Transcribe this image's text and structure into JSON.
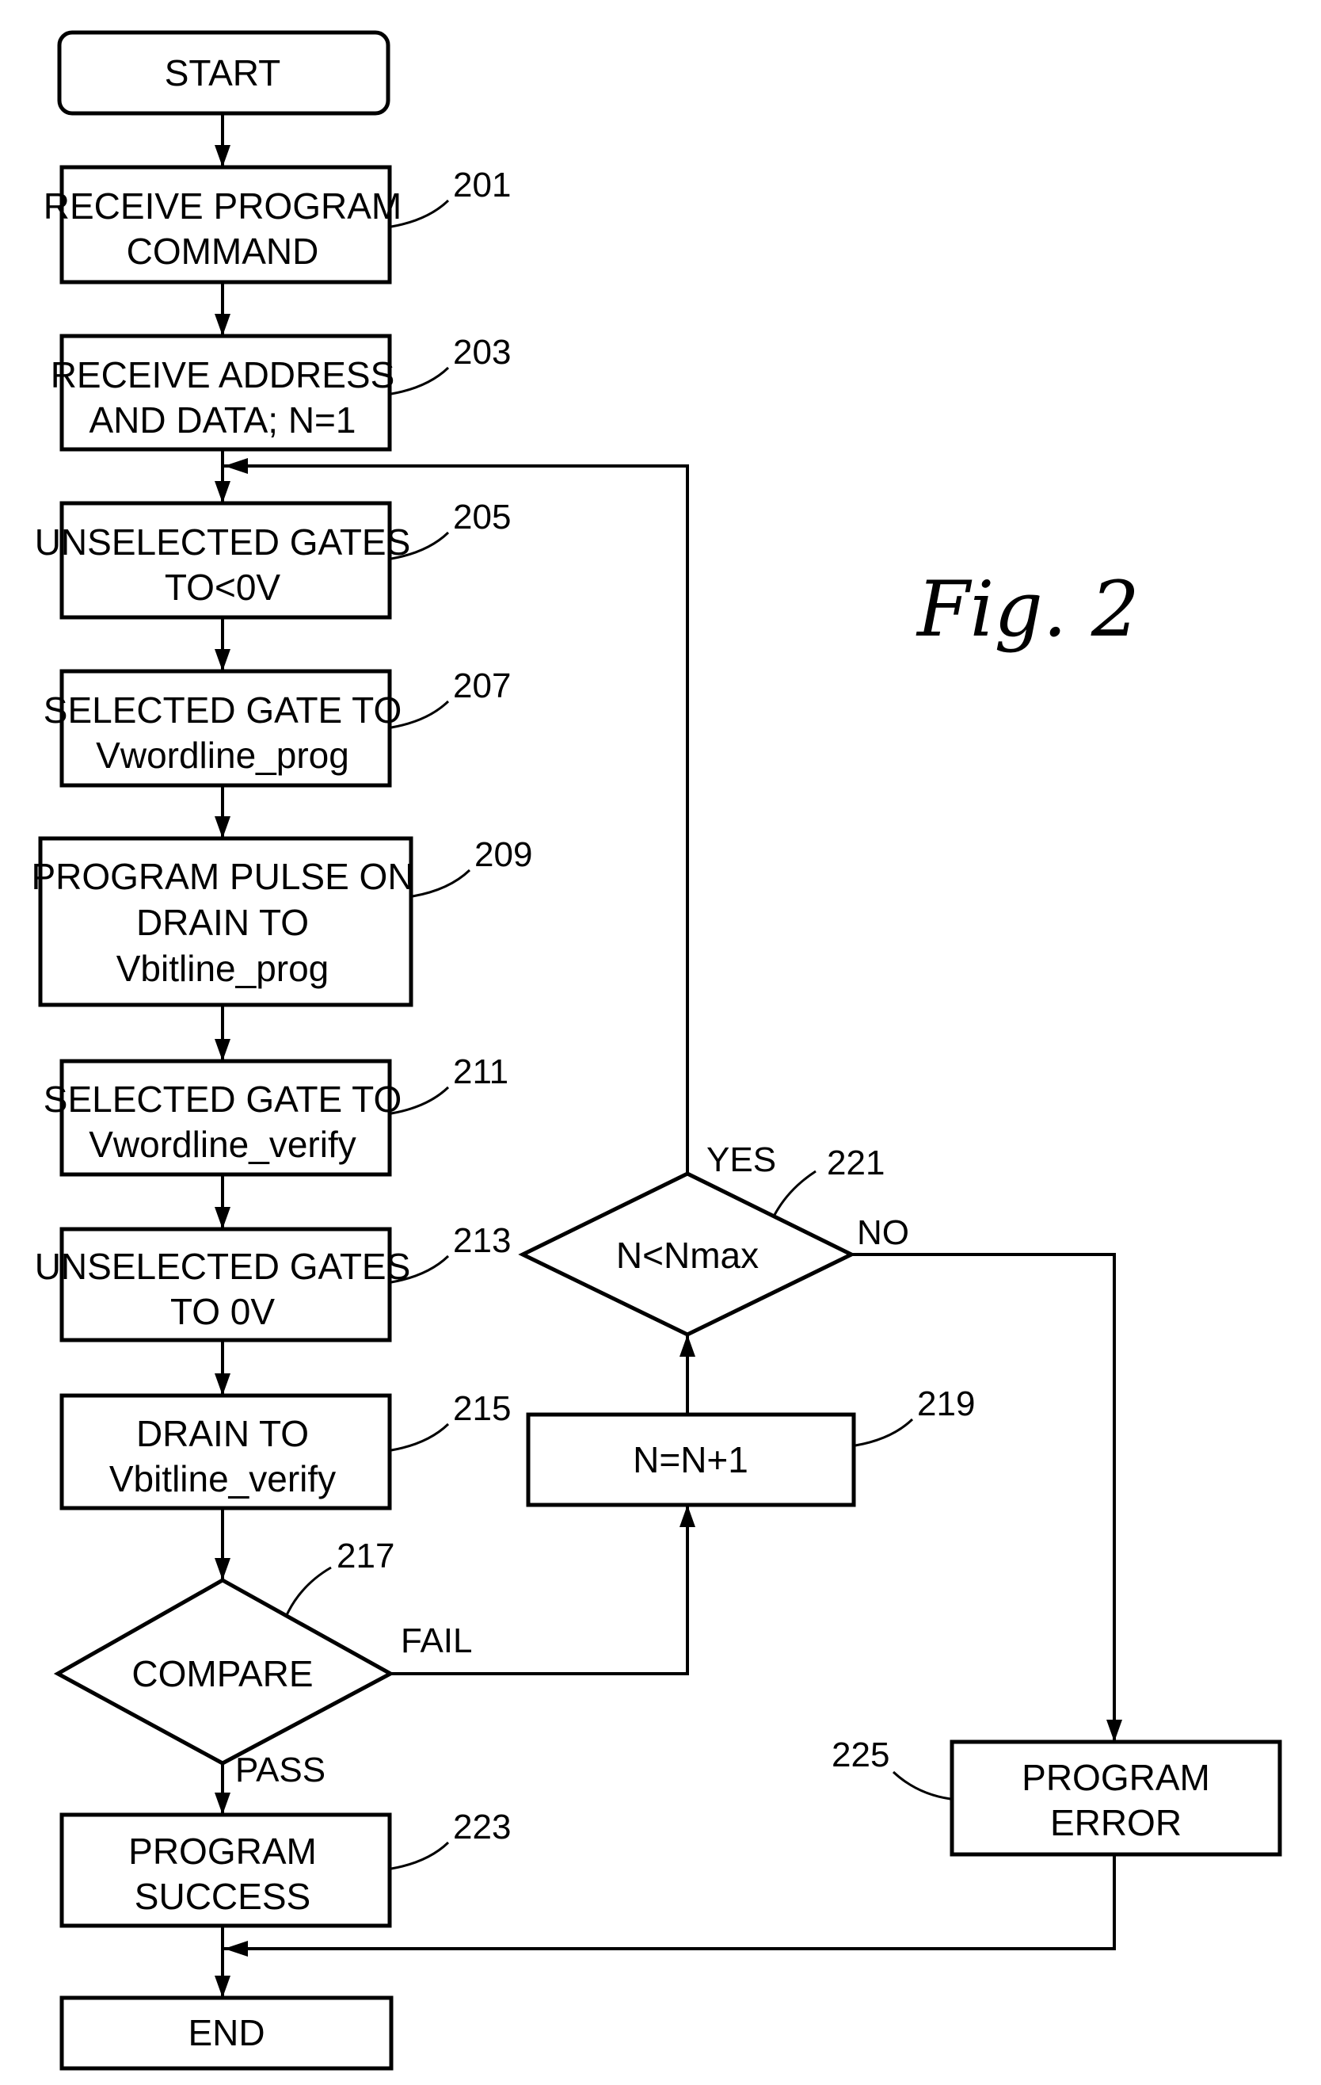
{
  "figure": {
    "title": "Fig. 2",
    "type": "flowchart"
  },
  "nodes": {
    "start": {
      "lines": [
        "START"
      ]
    },
    "n201": {
      "ref": "201",
      "lines": [
        "RECEIVE PROGRAM",
        "COMMAND"
      ]
    },
    "n203": {
      "ref": "203",
      "lines": [
        "RECEIVE ADDRESS",
        "AND DATA; N=1"
      ]
    },
    "n205": {
      "ref": "205",
      "lines": [
        "UNSELECTED GATES",
        "TO<0V"
      ]
    },
    "n207": {
      "ref": "207",
      "lines": [
        "SELECTED GATE TO",
        "Vwordline_prog"
      ]
    },
    "n209": {
      "ref": "209",
      "lines": [
        "PROGRAM PULSE ON",
        "DRAIN TO",
        "Vbitline_prog"
      ]
    },
    "n211": {
      "ref": "211",
      "lines": [
        "SELECTED GATE TO",
        "Vwordline_verify"
      ]
    },
    "n213": {
      "ref": "213",
      "lines": [
        "UNSELECTED GATES",
        "TO 0V"
      ]
    },
    "n215": {
      "ref": "215",
      "lines": [
        "DRAIN TO",
        "Vbitline_verify"
      ]
    },
    "n217": {
      "ref": "217",
      "lines": [
        "COMPARE"
      ]
    },
    "n219": {
      "ref": "219",
      "lines": [
        "N=N+1"
      ]
    },
    "n221": {
      "ref": "221",
      "lines": [
        "N<Nmax"
      ]
    },
    "n223": {
      "ref": "223",
      "lines": [
        "PROGRAM",
        "SUCCESS"
      ]
    },
    "n225": {
      "ref": "225",
      "lines": [
        "PROGRAM",
        "ERROR"
      ]
    },
    "end": {
      "lines": [
        "END"
      ]
    }
  },
  "edge_labels": {
    "fail": "FAIL",
    "pass": "PASS",
    "yes": "YES",
    "no": "NO"
  },
  "edges": [
    {
      "from": "start",
      "to": "n201"
    },
    {
      "from": "n201",
      "to": "n203"
    },
    {
      "from": "n203",
      "to": "n205"
    },
    {
      "from": "n205",
      "to": "n207"
    },
    {
      "from": "n207",
      "to": "n209"
    },
    {
      "from": "n209",
      "to": "n211"
    },
    {
      "from": "n211",
      "to": "n213"
    },
    {
      "from": "n213",
      "to": "n215"
    },
    {
      "from": "n215",
      "to": "n217"
    },
    {
      "from": "n217",
      "to": "n223",
      "label": "PASS"
    },
    {
      "from": "n217",
      "to": "n219",
      "label": "FAIL"
    },
    {
      "from": "n219",
      "to": "n221"
    },
    {
      "from": "n221",
      "to": "n205",
      "label": "YES"
    },
    {
      "from": "n221",
      "to": "n225",
      "label": "NO"
    },
    {
      "from": "n223",
      "to": "end"
    },
    {
      "from": "n225",
      "to": "end"
    }
  ]
}
